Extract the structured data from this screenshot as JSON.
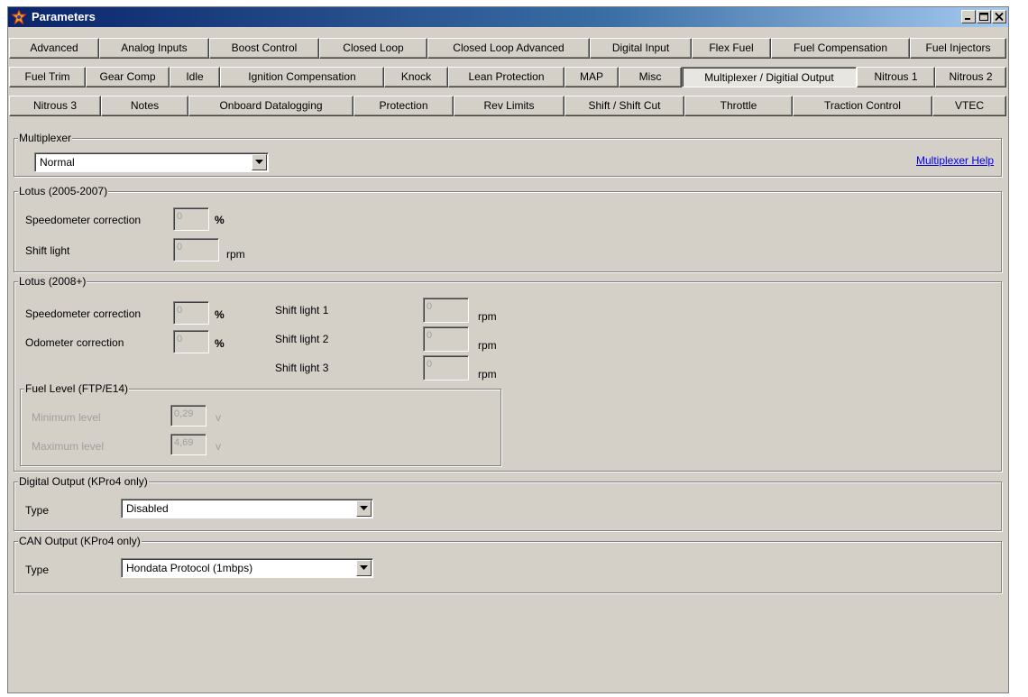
{
  "window": {
    "title": "Parameters"
  },
  "tabs": {
    "row1": [
      "Advanced",
      "Analog Inputs",
      "Boost Control",
      "Closed Loop",
      "Closed Loop Advanced",
      "Digital Input",
      "Flex Fuel",
      "Fuel Compensation",
      "Fuel Injectors"
    ],
    "row2": [
      "Fuel Trim",
      "Gear Comp",
      "Idle",
      "Ignition Compensation",
      "Knock",
      "Lean Protection",
      "MAP",
      "Misc",
      "Multiplexer / Digitial Output",
      "Nitrous 1",
      "Nitrous 2"
    ],
    "row3": [
      "Nitrous 3",
      "Notes",
      "Onboard Datalogging",
      "Protection",
      "Rev Limits",
      "Shift / Shift Cut",
      "Throttle",
      "Traction Control",
      "VTEC"
    ],
    "active": "Multiplexer / Digitial Output"
  },
  "multiplexer": {
    "label": "Multiplexer",
    "mode": "Normal",
    "help_link": "Multiplexer Help"
  },
  "lotus_2005": {
    "label": "Lotus (2005-2007)",
    "speedo_label": "Speedometer correction",
    "speedo_value": "0",
    "speedo_unit": "%",
    "shift_label": "Shift light",
    "shift_value": "0",
    "shift_unit": "rpm"
  },
  "lotus_2008": {
    "label": "Lotus (2008+)",
    "speedo_label": "Speedometer correction",
    "speedo_value": "0",
    "speedo_unit": "%",
    "odo_label": "Odometer correction",
    "odo_value": "0",
    "odo_unit": "%",
    "shift1_label": "Shift light 1",
    "shift1_value": "0",
    "shift1_unit": "rpm",
    "shift2_label": "Shift light 2",
    "shift2_value": "0",
    "shift2_unit": "rpm",
    "shift3_label": "Shift light 3",
    "shift3_value": "0",
    "shift3_unit": "rpm",
    "fuel_level": {
      "label": "Fuel Level (FTP/E14)",
      "min_label": "Minimum level",
      "min_value": "0,29",
      "min_unit": "v",
      "max_label": "Maximum level",
      "max_value": "4,69",
      "max_unit": "v"
    }
  },
  "digital_output": {
    "label": "Digital Output (KPro4 only)",
    "type_label": "Type",
    "type_value": "Disabled"
  },
  "can_output": {
    "label": "CAN Output (KPro4 only)",
    "type_label": "Type",
    "type_value": "Hondata Protocol (1mbps)"
  }
}
